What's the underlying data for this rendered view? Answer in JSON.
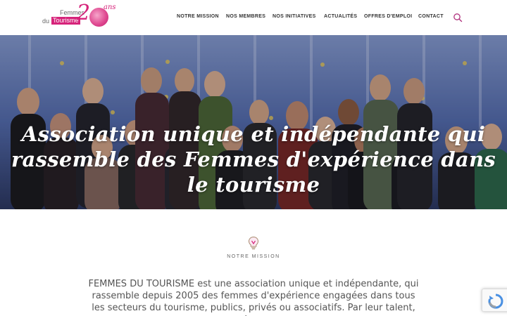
{
  "logo": {
    "line1": "Femmes",
    "line2_du": "du",
    "line2_tourisme": "Tourisme",
    "twenty": "2",
    "ans": "ans"
  },
  "nav": {
    "items": [
      "NOTRE MISSION",
      "NOS MEMBRES",
      "NOS INITIATIVES",
      "ACTUALITÉS",
      "OFFRES D'EMPLOI",
      "CONTACT"
    ]
  },
  "hero": {
    "title": "Association unique et indépendante qui rassemble des Femmes d'expérience dans le tourisme"
  },
  "mission": {
    "label": "NOTRE MISSION",
    "text": "FEMMES DU TOURISME est une association unique et indépendante, qui rassemble depuis 2005 des femmes d'expérience engagées dans tous les secteurs du tourisme, publics, privés ou associatifs. Par leur talent, leur"
  },
  "colors": {
    "brand": "#d6237a",
    "search_icon": "#b0327e"
  },
  "icons": {
    "search": "search-icon",
    "mission": "lightbulb-icon",
    "recaptcha": "recaptcha-icon"
  }
}
